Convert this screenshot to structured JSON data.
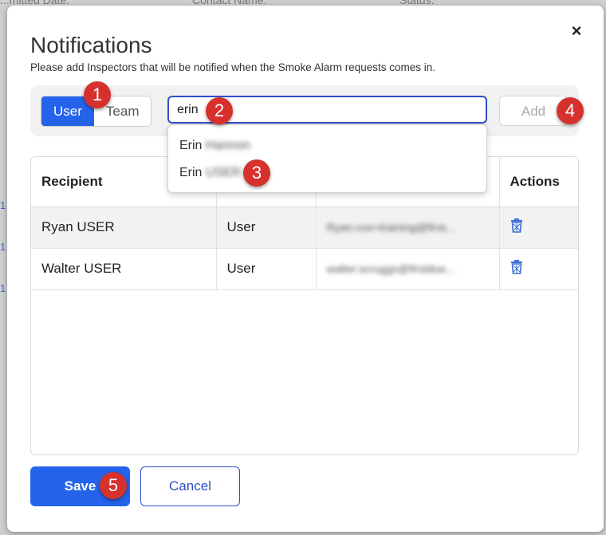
{
  "background": {
    "headers": [
      "...mitted Date:",
      "Contact Name:",
      "Status:"
    ],
    "links": [
      "1",
      "1",
      "1"
    ]
  },
  "modal": {
    "title": "Notifications",
    "subtitle": "Please add Inspectors that will be notified when the Smoke Alarm requests comes in.",
    "close_label": "×"
  },
  "toolbar": {
    "segments": [
      {
        "label": "User",
        "active": true
      },
      {
        "label": "Team",
        "active": false
      }
    ],
    "search_value": "erin",
    "add_label": "Add"
  },
  "dropdown": {
    "items": [
      {
        "first": "Erin",
        "last": "Hannon"
      },
      {
        "first": "Erin",
        "last": "USER"
      }
    ]
  },
  "table": {
    "headers": [
      "Recipient",
      "",
      "",
      "Actions"
    ],
    "rows": [
      {
        "recipient": "Ryan USER",
        "type": "User",
        "email": "Ryan.cox+training@first..."
      },
      {
        "recipient": "Walter USER",
        "type": "User",
        "email": "walter.scruggs@firstdue..."
      }
    ]
  },
  "footer": {
    "save_label": "Save",
    "cancel_label": "Cancel"
  },
  "badges": [
    "1",
    "2",
    "3",
    "4",
    "5"
  ],
  "colors": {
    "accent": "#2563eb",
    "badge": "#d6312d",
    "trash": "#3b6fd4"
  }
}
